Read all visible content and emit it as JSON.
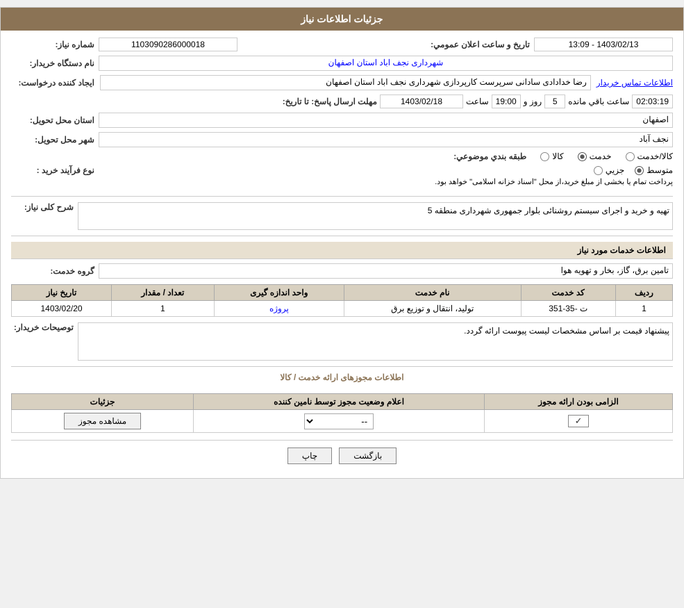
{
  "header": {
    "title": "جزئيات اطلاعات نياز"
  },
  "top_section": {
    "need_number_label": "شماره نياز:",
    "need_number_value": "1103090286000018",
    "announce_date_label": "تاريخ و ساعت اعلان عمومي:",
    "announce_date_value": "1403/02/13 - 13:09",
    "buyer_org_label": "نام دستگاه خريدار:",
    "buyer_org_value": "شهرداری نجف اباد استان اصفهان",
    "creator_label": "ايجاد کننده درخواست:",
    "creator_value": "رضا خدادادی سادانی سرپرست  کارپردازی شهرداری نجف اباد استان اصفهان",
    "contact_link": "اطلاعات تماس خريدار",
    "deadline_label": "مهلت ارسال پاسخ: تا تاريخ:",
    "deadline_date": "1403/02/18",
    "deadline_time_label": "ساعت",
    "deadline_time": "19:00",
    "deadline_days_label": "روز و",
    "deadline_days": "5",
    "deadline_remaining_label": "ساعت باقي مانده",
    "deadline_remaining": "02:03:19",
    "province_label": "استان محل تحويل:",
    "province_value": "اصفهان",
    "city_label": "شهر محل تحويل:",
    "city_value": "نجف آباد",
    "category_label": "طبقه بندي موضوعي:",
    "category_kala": "کالا",
    "category_khadamat": "خدمت",
    "category_kala_khadamat": "کالا/خدمت",
    "category_khadamat_selected": true,
    "process_label": "نوع فرآيند خريد :",
    "process_jozi": "جزيي",
    "process_motavasset": "متوسط",
    "process_motavasset_selected": true,
    "process_note": "پرداخت تمام يا بخشی از مبلغ خريد،از محل \"اسناد خزانه اسلامی\" خواهد بود."
  },
  "description_section": {
    "title": "شرح کلی نياز:",
    "value": "تهيه و خريد و اجرای سيستم روشنائی بلوار جمهوری شهرداری منطقه 5"
  },
  "service_info_section": {
    "title": "اطلاعات خدمات مورد نياز",
    "service_group_label": "گروه خدمت:",
    "service_group_value": "تامين برق، گاز، بخار و تهويه هوا",
    "table": {
      "columns": [
        "رديف",
        "کد خدمت",
        "نام خدمت",
        "واحد اندازه گيری",
        "تعداد / مقدار",
        "تاريخ نياز"
      ],
      "rows": [
        {
          "row_num": "1",
          "service_code": "ت -35-351",
          "service_name": "توليد، انتقال و توزيع برق",
          "unit": "پروژه",
          "quantity": "1",
          "date": "1403/02/20"
        }
      ]
    }
  },
  "buyer_notes_section": {
    "label": "توصيحات خريدار:",
    "value": "پيشنهاد قيمت بر اساس مشخصات ليست پيوست ارائه گردد."
  },
  "permits_section": {
    "title": "اطلاعات مجوزهای ارائه خدمت / کالا",
    "table": {
      "columns": [
        "الزامی بودن ارائه مجوز",
        "اعلام وضعيت مجوز توسط نامين کننده",
        "جزئيات"
      ],
      "rows": [
        {
          "required": true,
          "status": "--",
          "details_btn": "مشاهده مجوز"
        }
      ]
    }
  },
  "actions": {
    "print_label": "چاپ",
    "back_label": "بازگشت"
  }
}
